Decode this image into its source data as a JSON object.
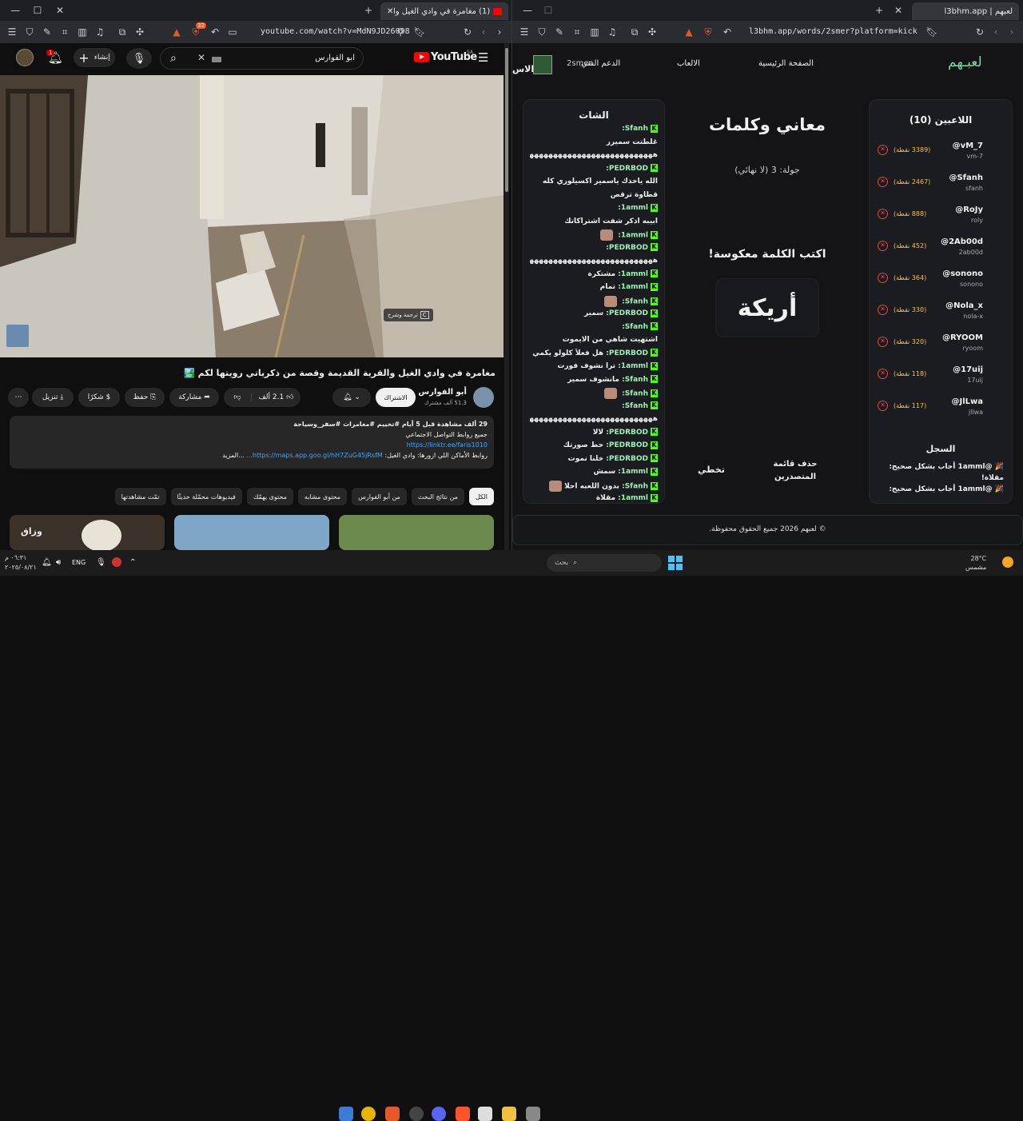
{
  "left_window": {
    "tab_title": "(1) مغامرة في وادي الغيل والقر",
    "url": "youtube.com/watch?v=MdN9JD26098",
    "brave_badge": "32"
  },
  "right_window": {
    "tab_title": "لعبهم | l3bhm.app",
    "url": "l3bhm.app/words/2smer?platform=kick"
  },
  "youtube": {
    "logo": "YouTube",
    "logo_region": "SA",
    "search_value": "ابو الفوارس",
    "create_label": "إنشاء",
    "notif_count": "1",
    "caption_btn": "ترجمة وشرح",
    "caption_key": "C",
    "video_title": "مغامرة في وادي الغيل والقرية القديمة وقصة من ذكرياتي رويتها لكم 🏞️",
    "channel_name": "أبو الفوارس",
    "subscribers": "51.3 ألف مشترك",
    "subscribe": "الاشتراك",
    "likes": "2.1 ألف",
    "share": "مشاركة",
    "save": "حفظ",
    "thanks": "شكرًا",
    "download": "تنزيل",
    "desc_stats": "29 ألف مشاهدة قبل 5 أيام #تخييم #مغامرات #سفر_وسياحة",
    "desc_line2": "جميع روابط التواصل الاجتماعي",
    "desc_link": "https://linktr.ee/faris1010",
    "desc_line4a": "روابط الأماكن اللي ازورها: وادي الغيل: ",
    "desc_link2": "https://maps.app.goo.gl/hH7ZuG45jRsfM...",
    "desc_more": "...المزيد",
    "chips": [
      "الكل",
      "من نتائج البحث",
      "من أبو الفوارس",
      "محتوى مشابه",
      "محتوى يهمّك",
      "فيديوهات محمّلة حديثًا",
      "تمّت مشاهدتها"
    ],
    "thumb1_text": "وزاق"
  },
  "game": {
    "logo": "لعبـهم",
    "nav": [
      "الصفحة الرئيسية",
      "الالعاب",
      "الدعم الفني"
    ],
    "user": "2smer",
    "edge_text": "الاس",
    "players_title": "اللاعبين (10)",
    "players": [
      {
        "name": "@vM_7",
        "sub": "vm-7",
        "pts": "(3389 نقطة)"
      },
      {
        "name": "@Sfanh",
        "sub": "sfanh",
        "pts": "(2467 نقطة)"
      },
      {
        "name": "@RoJy",
        "sub": "roly",
        "pts": "(888 نقطة)"
      },
      {
        "name": "@2Ab00d",
        "sub": "2ab00d",
        "pts": "(452 نقطة)"
      },
      {
        "name": "@sonono",
        "sub": "sonono",
        "pts": "(364 نقطة)"
      },
      {
        "name": "@Nola_x",
        "sub": "nola-x",
        "pts": "(330 نقطة)"
      },
      {
        "name": "@RYOOM",
        "sub": "ryoom",
        "pts": "(320 نقطة)"
      },
      {
        "name": "@17uij",
        "sub": "17uij",
        "pts": "(118 نقطة)"
      },
      {
        "name": "@JlLwa",
        "sub": "jllwa",
        "pts": "(117 نقطة)"
      }
    ],
    "log_title": "السجل",
    "log": [
      "🎉 @1amml أجاب بشكل صحيح: مقلاة!",
      "🎉 @1amml أجاب بشكل صحيح:"
    ],
    "center_title": "معاني وكلمات",
    "round": "جولة: 3 (لا نهائي)",
    "prompt": "اكتب الكلمة معكوسة!",
    "word": "أريكة",
    "btn_clear": "حذف قائمة المتصدرين",
    "btn_skip": "تخطي",
    "chat_title": "الشات",
    "chat": [
      {
        "u": "Sfanh:",
        "m": ""
      },
      {
        "u": "",
        "m": "غلطتت سميرر"
      },
      {
        "u": "",
        "m": "ههههههههههههههههههههههههههههه"
      },
      {
        "u": "PEDRBOD:",
        "m": ""
      },
      {
        "u": "",
        "m": "الله ياخذك ياسمير اكسيلوري كله"
      },
      {
        "u": "",
        "m": "قطاوة ترقص"
      },
      {
        "u": "1amml:",
        "m": ""
      },
      {
        "u": "",
        "m": "ابيبه اذكر شفت اشتراكاتك"
      },
      {
        "u": "1amml:",
        "m": "",
        "e": true
      },
      {
        "u": "PEDRBOD:",
        "m": ""
      },
      {
        "u": "",
        "m": "ههههههههههههههههههههههههههههه"
      },
      {
        "u": "1amml:",
        "m": "مشتكرة"
      },
      {
        "u": "1amml:",
        "m": "تمام"
      },
      {
        "u": "Sfanh:",
        "m": "",
        "e": true
      },
      {
        "u": "PEDRBOD:",
        "m": "سمير"
      },
      {
        "u": "Sfanh:",
        "m": ""
      },
      {
        "u": "",
        "m": "اشتهيت شاهي من الايموت"
      },
      {
        "u": "PEDRBOD:",
        "m": "هل فعلاً كلولو يكمي"
      },
      {
        "u": "1amml:",
        "m": "ترا نشوف فورت"
      },
      {
        "u": "Sfanh:",
        "m": "مانشوف سمير"
      },
      {
        "u": "Sfanh:",
        "m": "",
        "e": true
      },
      {
        "u": "Sfanh:",
        "m": ""
      },
      {
        "u": "",
        "m": "ههههههههههههههههههههههههههههه"
      },
      {
        "u": "PEDRBOD:",
        "m": "لالا"
      },
      {
        "u": "PEDRBOD:",
        "m": "حط صورتك"
      },
      {
        "u": "PEDRBOD:",
        "m": "خلنا نموت"
      },
      {
        "u": "1amml:",
        "m": "سمش"
      },
      {
        "u": "Sfanh:",
        "m": "بدون اللعبه احلا",
        "e": true
      },
      {
        "u": "1amml:",
        "m": "مقلاة"
      },
      {
        "u": "1amml:",
        "m": "",
        "e": true
      },
      {
        "u": "Sfanh:",
        "m": "",
        "e": true
      }
    ],
    "footer": "© لعبهم 2026 جميع الحقوق محفوظة."
  },
  "taskbar": {
    "weather_temp": "28°C",
    "weather_desc": "مشمس",
    "search": "بحث",
    "lang": "ENG",
    "time": "٠٦:٣١ م",
    "date": "٢٠٢٥/٠٨/٢١"
  }
}
